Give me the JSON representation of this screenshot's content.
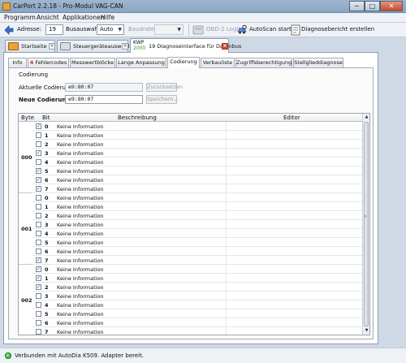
{
  "window": {
    "title": "CarPort 2.2.18  -  Pro-Modul VAG-CAN",
    "min": "─",
    "max": "□",
    "close": "✕"
  },
  "menu": [
    "Programm",
    "Ansicht",
    "Applikationen",
    "Hilfe"
  ],
  "toolbar": {
    "address_label": "Adresse:",
    "address_value": "19",
    "bus_label": "Busauswahl:",
    "bus_value": "Auto",
    "baud_label": "Baudrate:",
    "baud_value": "",
    "obd_login": "OBD-2 Login",
    "autoscan": "AutoScan starten",
    "diag_report": "Diagnosebericht erstellen"
  },
  "main_tabs": [
    {
      "label": "Startseite"
    },
    {
      "label": "Steuergeräteauswahl"
    },
    {
      "kwp_top": "KWP",
      "kwp_num": "2000",
      "label": "19 Diagnoseinterface für Datenbus"
    }
  ],
  "sub_tabs": [
    "Info",
    "Fehlercodes",
    "Messwertblöcke",
    "Lange Anpassung",
    "Codierung",
    "Verbauliste",
    "Zugriffsberechtigung",
    "Stellglieddiagnose"
  ],
  "sub_tab_warning": "4",
  "coding": {
    "legend": "Codierung",
    "current_label": "Aktuelle Codierung:",
    "current_value": "e9:80:07",
    "reset_button": "Zurücksetzen",
    "new_label": "Neue Codierung:",
    "new_value": "e9:80:07",
    "save_button": "Speichern..."
  },
  "table": {
    "headers": {
      "byte": "Byte",
      "bit": "Bit",
      "desc": "Beschreibung",
      "editor": "Editor"
    },
    "bytes": [
      {
        "byte": "000",
        "bits": [
          {
            "bit": "0",
            "checked": true,
            "desc": "Keine Information"
          },
          {
            "bit": "1",
            "checked": false,
            "desc": "Keine Information"
          },
          {
            "bit": "2",
            "checked": false,
            "desc": "Keine Information"
          },
          {
            "bit": "3",
            "checked": true,
            "desc": "Keine Information"
          },
          {
            "bit": "4",
            "checked": false,
            "desc": "Keine Information"
          },
          {
            "bit": "5",
            "checked": true,
            "desc": "Keine Information"
          },
          {
            "bit": "6",
            "checked": true,
            "desc": "Keine Information"
          },
          {
            "bit": "7",
            "checked": true,
            "desc": "Keine Information"
          }
        ]
      },
      {
        "byte": "001",
        "bits": [
          {
            "bit": "0",
            "checked": false,
            "desc": "Keine Information"
          },
          {
            "bit": "1",
            "checked": false,
            "desc": "Keine Information"
          },
          {
            "bit": "2",
            "checked": false,
            "desc": "Keine Information"
          },
          {
            "bit": "3",
            "checked": false,
            "desc": "Keine Information"
          },
          {
            "bit": "4",
            "checked": false,
            "desc": "Keine Information"
          },
          {
            "bit": "5",
            "checked": false,
            "desc": "Keine Information"
          },
          {
            "bit": "6",
            "checked": false,
            "desc": "Keine Information"
          },
          {
            "bit": "7",
            "checked": true,
            "desc": "Keine Information"
          }
        ]
      },
      {
        "byte": "002",
        "bits": [
          {
            "bit": "0",
            "checked": true,
            "desc": "Keine Information"
          },
          {
            "bit": "1",
            "checked": true,
            "desc": "Keine Information"
          },
          {
            "bit": "2",
            "checked": true,
            "desc": "Keine Information"
          },
          {
            "bit": "3",
            "checked": false,
            "desc": "Keine Information"
          },
          {
            "bit": "4",
            "checked": false,
            "desc": "Keine Information"
          },
          {
            "bit": "5",
            "checked": false,
            "desc": "Keine Information"
          },
          {
            "bit": "6",
            "checked": false,
            "desc": "Keine Information"
          },
          {
            "bit": "7",
            "checked": false,
            "desc": "Keine Information"
          }
        ]
      }
    ]
  },
  "status": {
    "message": "Verbunden mit AutoDia K509. Adapter bereit."
  },
  "colors": {
    "accent": "#2d9b2d",
    "warning": "#d2281b",
    "title_bar": "#9fb6cf"
  }
}
